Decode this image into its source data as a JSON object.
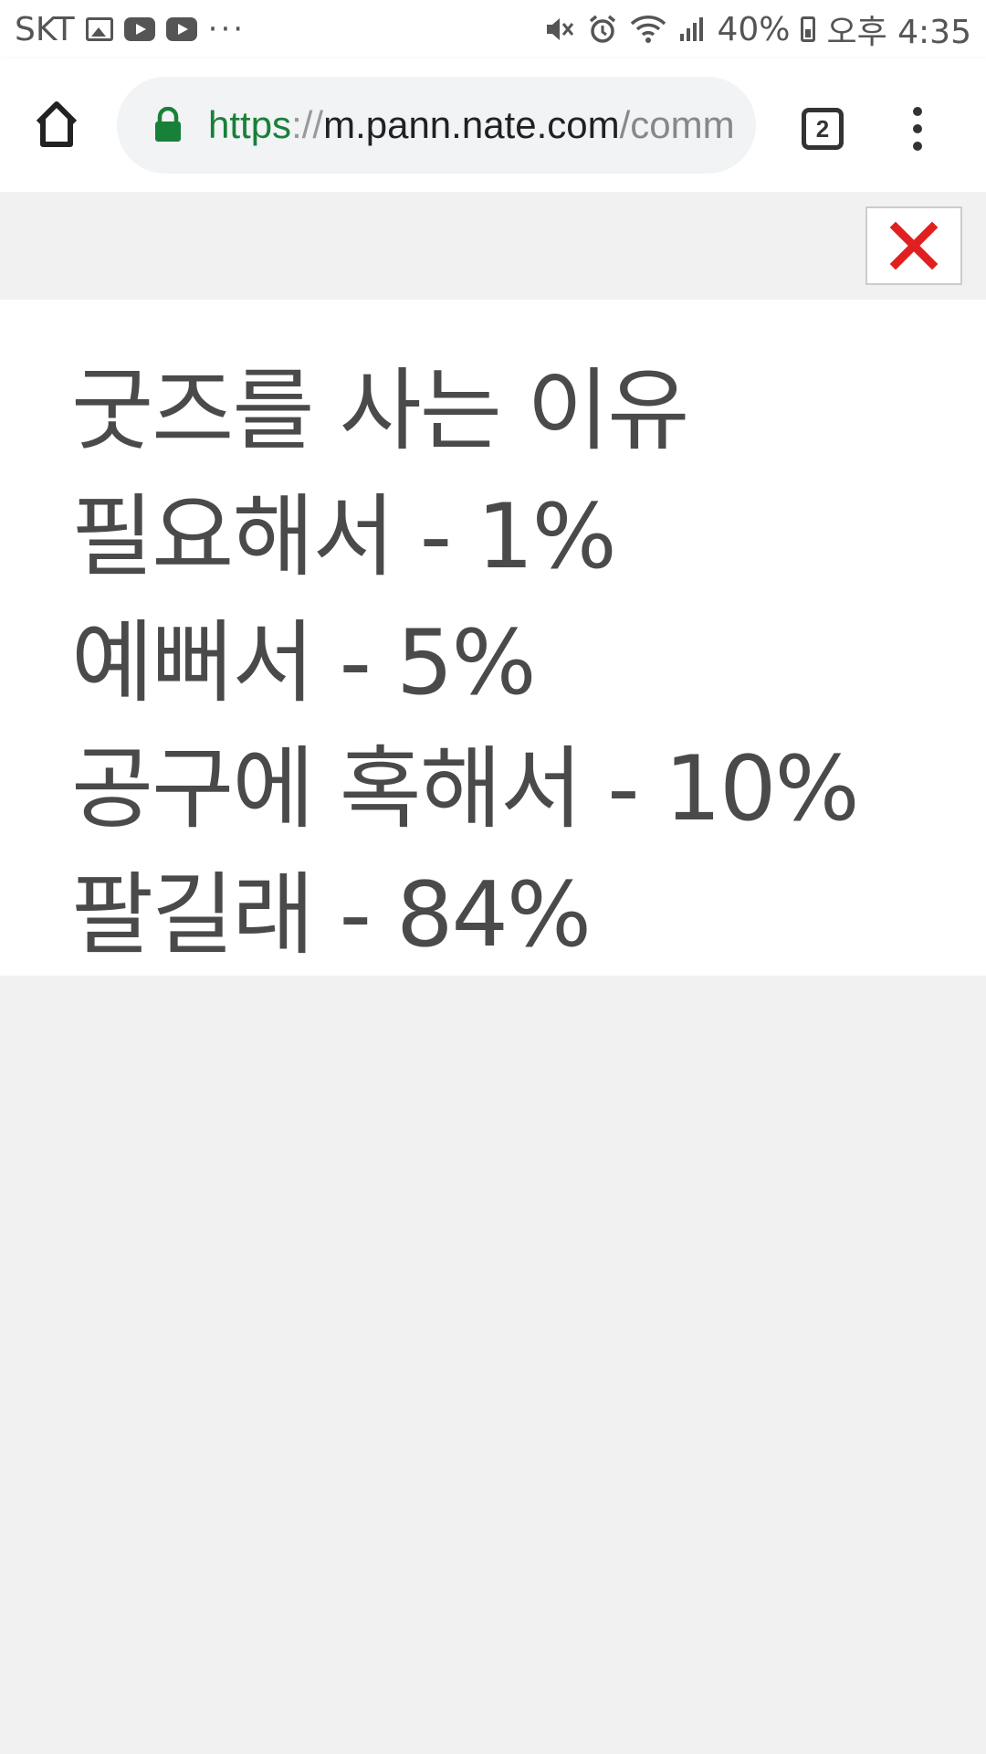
{
  "status_bar": {
    "carrier": "SKT",
    "overflow": "···",
    "battery": "40%",
    "time": "오후 4:35",
    "icons": [
      "image-icon",
      "youtube-icon",
      "youtube-icon",
      "mute-icon",
      "alarm-icon",
      "wifi-icon",
      "signal-icon",
      "battery-icon"
    ]
  },
  "browser": {
    "url_scheme": "https",
    "url_sep": "://",
    "url_host": "m.pann.nate.com",
    "url_path": "/comm",
    "tab_count": "2",
    "lock_color": "#188038"
  },
  "close_button": {
    "icon": "close-icon",
    "color": "#e02020"
  },
  "content": {
    "lines": [
      "굿즈를 사는 이유",
      "필요해서 - 1%",
      "예뻐서 - 5%",
      "공구에 혹해서 - 10%",
      "팔길래 - 84%"
    ]
  }
}
